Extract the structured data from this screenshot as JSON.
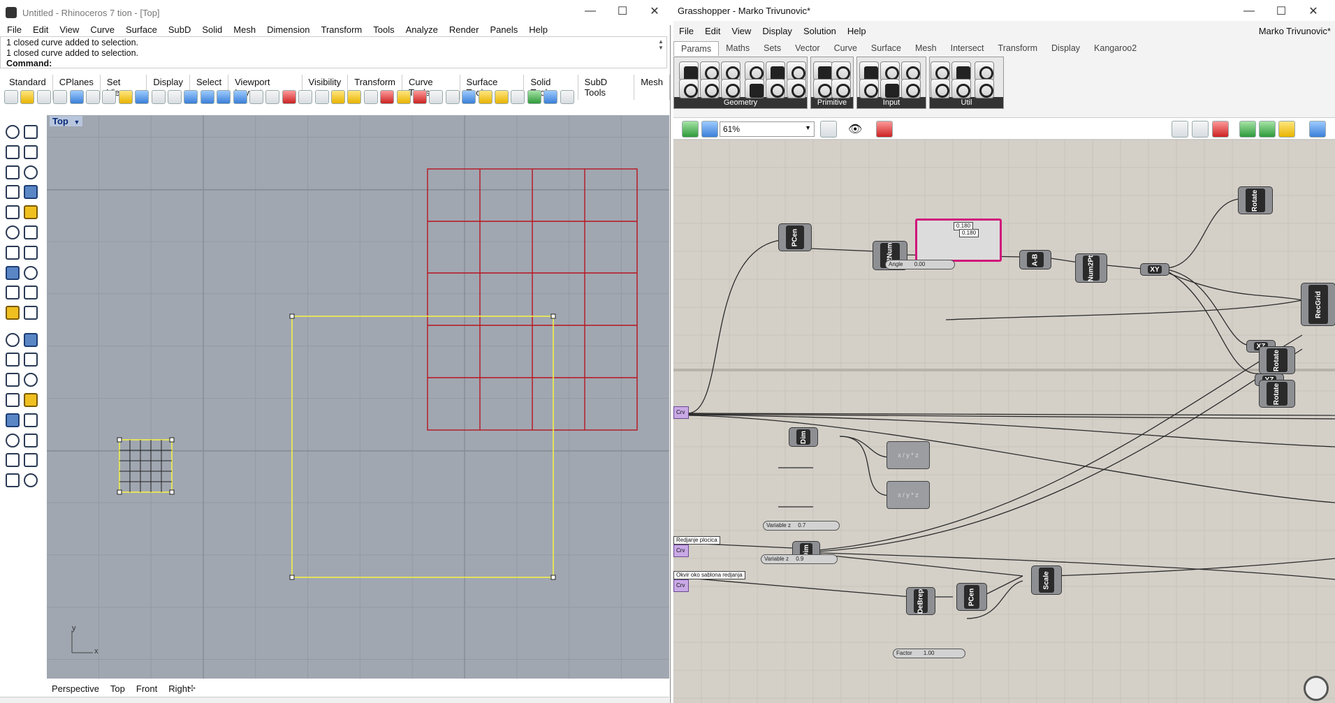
{
  "rhino": {
    "title": "Untitled - Rhinoceros 7 tion - [Top]",
    "menu": [
      "File",
      "Edit",
      "View",
      "Curve",
      "Surface",
      "SubD",
      "Solid",
      "Mesh",
      "Dimension",
      "Transform",
      "Tools",
      "Analyze",
      "Render",
      "Panels",
      "Help"
    ],
    "history": [
      "1 closed curve added to selection.",
      "1 closed curve added to selection."
    ],
    "command_label": "Command:",
    "toolbar_tabs": [
      "Standard",
      "CPlanes",
      "Set View",
      "Display",
      "Select",
      "Viewport Layout",
      "Visibility",
      "Transform",
      "Curve Tools",
      "Surface Tools",
      "Solid Tools",
      "SubD Tools",
      "Mesh"
    ],
    "viewport_label": "Top",
    "axis_y": "y",
    "axis_x": "x",
    "viewport_tabs": [
      "Perspective",
      "Top",
      "Front",
      "Right"
    ],
    "colors": {
      "viewport_bg": "#a0a7b1",
      "red_curve": "#b81420",
      "yellow_curve": "#f4f04a",
      "grid_line": "#8c939c"
    }
  },
  "grasshopper": {
    "title": "Grasshopper - Marko Trivunovic*",
    "user": "Marko Trivunovic*",
    "menu": [
      "File",
      "Edit",
      "View",
      "Display",
      "Solution",
      "Help"
    ],
    "ribbon_tabs": [
      "Params",
      "Maths",
      "Sets",
      "Vector",
      "Curve",
      "Surface",
      "Mesh",
      "Intersect",
      "Transform",
      "Display",
      "Kangaroo2"
    ],
    "groups": [
      "Geometry",
      "Primitive",
      "Input",
      "Util"
    ],
    "zoom": "61%",
    "components": {
      "pcen": "PCen",
      "pt2num": "Pt2Num",
      "amb": "A-B",
      "num2pt": "Num2Pt",
      "xy": "XY",
      "rotate": "Rotate",
      "xz": "XZ",
      "yz": "YZ",
      "recgrid": "RecGrid",
      "dim": "Dim",
      "scale": "Scale",
      "debrep": "DeBrep"
    },
    "sliders": {
      "angle": {
        "label": "Angle",
        "value": "0.00"
      },
      "varz1": {
        "label": "Variable z",
        "value": "0.7"
      },
      "varz2": {
        "label": "Variable z",
        "value": "0.9"
      },
      "factor": {
        "label": "Factor",
        "value": "1.00"
      }
    },
    "panels": {
      "p1": "Redjanje plocica",
      "p2": "Okvir oko sablona redjanja",
      "pin": "0.180",
      "pin2": "0.180"
    },
    "params": {
      "crv": "Crv"
    },
    "colors": {
      "canvas": "#d4d0c8",
      "wire": "#2b2b2b",
      "pink": "#d0157a",
      "selected_border": "#d0157a"
    }
  }
}
